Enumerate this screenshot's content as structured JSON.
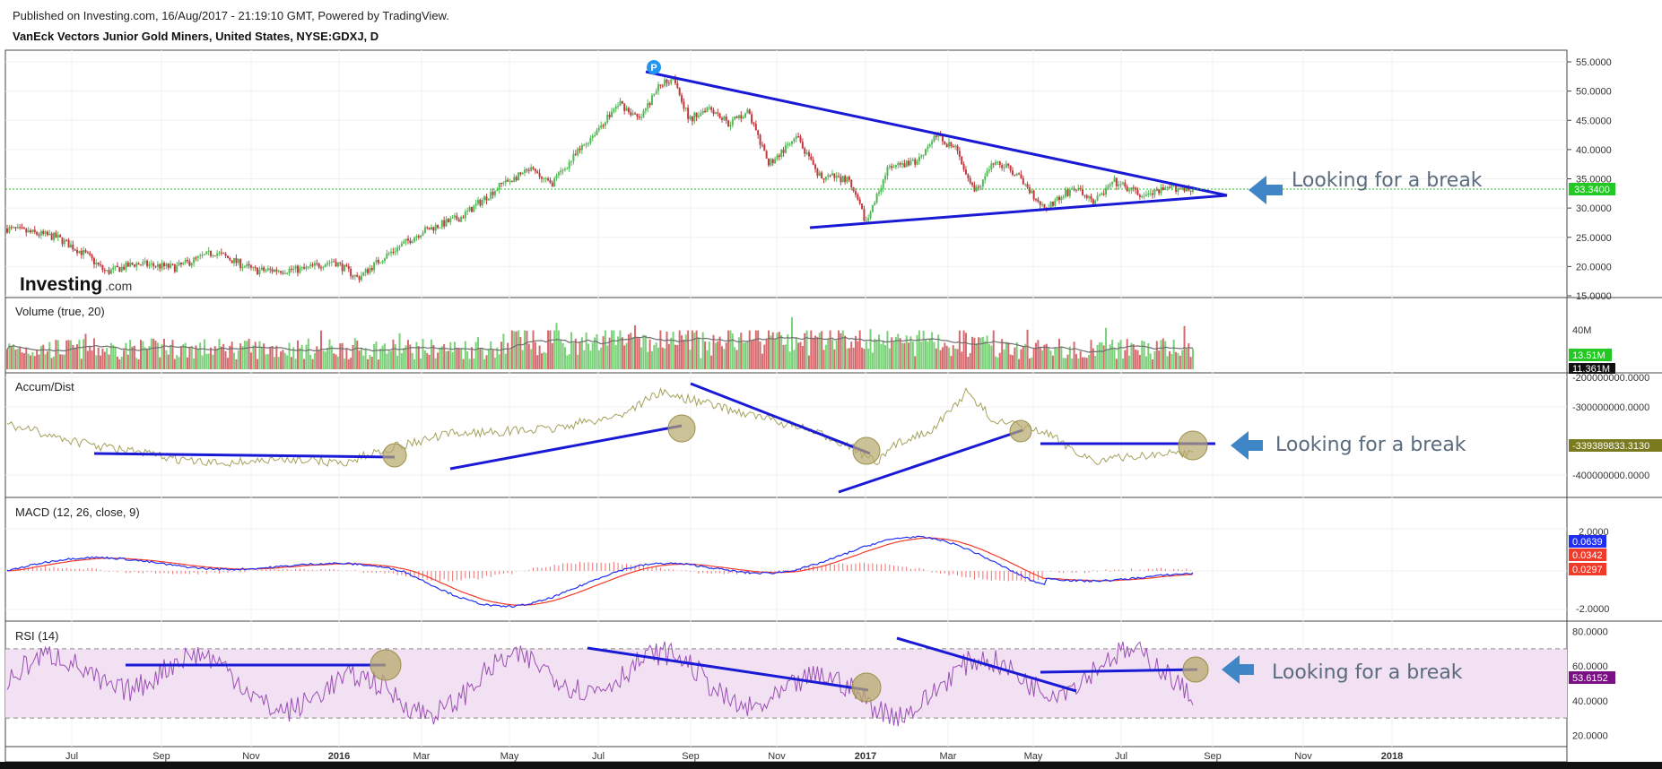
{
  "header": {
    "published": "Published on Investing.com, 16/Aug/2017 - 21:19:10 GMT, Powered by TradingView.",
    "symbol": "VanEck Vectors Junior Gold Miners, United States, NYSE:GDXJ, D"
  },
  "logo": {
    "main": "Investing",
    "suffix": ".com"
  },
  "time_axis": {
    "labels": [
      {
        "text": "Jul",
        "bold": false
      },
      {
        "text": "Sep",
        "bold": false
      },
      {
        "text": "Nov",
        "bold": false
      },
      {
        "text": "2016",
        "bold": true
      },
      {
        "text": "Mar",
        "bold": false
      },
      {
        "text": "May",
        "bold": false
      },
      {
        "text": "Jul",
        "bold": false
      },
      {
        "text": "Sep",
        "bold": false
      },
      {
        "text": "Nov",
        "bold": false
      },
      {
        "text": "2017",
        "bold": true
      },
      {
        "text": "Mar",
        "bold": false
      },
      {
        "text": "May",
        "bold": false
      },
      {
        "text": "Jul",
        "bold": false
      },
      {
        "text": "Sep",
        "bold": false
      },
      {
        "text": "Nov",
        "bold": false
      },
      {
        "text": "2018",
        "bold": true
      }
    ]
  },
  "colors": {
    "up": "#53b957",
    "down": "#c0393f",
    "trendline": "#1a1ad6",
    "annotation_arrow": "#3f86c7",
    "ad_line": "#a4a25c",
    "macd": "#1f2ef2",
    "signal": "#f23a2a",
    "rsi": "#9b4fb5",
    "rsi_band": "#f1e1f2",
    "highlight_circle": "#b7a86c"
  },
  "chart_data": [
    {
      "type": "candlestick",
      "title": "VanEck Vectors Junior Gold Miners, United States, NYSE:GDXJ, D",
      "x_range": [
        "2015-05",
        "2017-08-16"
      ],
      "ylim": [
        15,
        55
      ],
      "y_ticks": [
        "15.0000",
        "20.0000",
        "25.0000",
        "30.0000",
        "35.0000",
        "40.0000",
        "45.0000",
        "50.0000",
        "55.0000"
      ],
      "last_value": "33.3400",
      "close_path": [
        {
          "t": 0.0,
          "v": 26.5
        },
        {
          "t": 0.05,
          "v": 25.0
        },
        {
          "t": 0.08,
          "v": 22.0
        },
        {
          "t": 0.1,
          "v": 19.0
        },
        {
          "t": 0.13,
          "v": 20.5
        },
        {
          "t": 0.17,
          "v": 19.8
        },
        {
          "t": 0.21,
          "v": 22.5
        },
        {
          "t": 0.25,
          "v": 19.3
        },
        {
          "t": 0.3,
          "v": 19.5
        },
        {
          "t": 0.33,
          "v": 21.0
        },
        {
          "t": 0.355,
          "v": 18.0
        },
        {
          "t": 0.38,
          "v": 21.5
        },
        {
          "t": 0.42,
          "v": 26.0
        },
        {
          "t": 0.46,
          "v": 28.5
        },
        {
          "t": 0.5,
          "v": 34.0
        },
        {
          "t": 0.53,
          "v": 36.5
        },
        {
          "t": 0.55,
          "v": 34.0
        },
        {
          "t": 0.58,
          "v": 40.0
        },
        {
          "t": 0.62,
          "v": 48.0
        },
        {
          "t": 0.64,
          "v": 45.0
        },
        {
          "t": 0.66,
          "v": 51.0
        },
        {
          "t": 0.675,
          "v": 52.5
        },
        {
          "t": 0.69,
          "v": 45.0
        },
        {
          "t": 0.71,
          "v": 47.5
        },
        {
          "t": 0.73,
          "v": 44.5
        },
        {
          "t": 0.75,
          "v": 46.5
        },
        {
          "t": 0.77,
          "v": 37.5
        },
        {
          "t": 0.8,
          "v": 42.0
        },
        {
          "t": 0.82,
          "v": 35.5
        },
        {
          "t": 0.85,
          "v": 35.0
        },
        {
          "t": 0.87,
          "v": 27.5
        },
        {
          "t": 0.89,
          "v": 36.5
        },
        {
          "t": 0.92,
          "v": 38.0
        },
        {
          "t": 0.94,
          "v": 42.5
        },
        {
          "t": 0.96,
          "v": 40.0
        },
        {
          "t": 0.98,
          "v": 33.0
        },
        {
          "t": 1.0,
          "v": 38.0
        },
        {
          "t": 1.02,
          "v": 36.0
        },
        {
          "t": 1.05,
          "v": 30.0
        },
        {
          "t": 1.08,
          "v": 33.5
        },
        {
          "t": 1.1,
          "v": 31.0
        },
        {
          "t": 1.12,
          "v": 34.5
        },
        {
          "t": 1.15,
          "v": 32.0
        },
        {
          "t": 1.18,
          "v": 33.5
        },
        {
          "t": 1.2,
          "v": 33.3
        }
      ]
    },
    {
      "type": "bar",
      "title": "Volume (true, 20)",
      "y_ticks": [
        "40M"
      ],
      "values_in_labels": [
        "13.51M",
        "11.361M"
      ]
    },
    {
      "type": "line",
      "title": "Accum/Dist",
      "y_ticks": [
        "-200000000.0000",
        "-300000000.0000",
        "-400000000.0000"
      ],
      "last_value": "-339389833.3130"
    },
    {
      "type": "line",
      "title": "MACD (12, 26, close, 9)",
      "y_ticks": [
        "2.0000",
        "-2.0000"
      ],
      "last_values": [
        "0.0639",
        "0.0342",
        "0.0297"
      ]
    },
    {
      "type": "line",
      "title": "RSI (14)",
      "ylim": [
        15,
        85
      ],
      "y_ticks": [
        "20.0000",
        "40.0000",
        "60.0000",
        "80.0000"
      ],
      "band": [
        30,
        70
      ],
      "last_value": "53.6152"
    }
  ],
  "annotations": {
    "break_text": "Looking for a break",
    "marker_label": "P"
  }
}
